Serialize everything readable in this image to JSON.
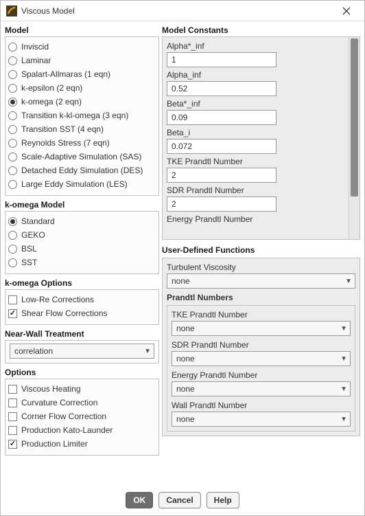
{
  "window": {
    "title": "Viscous Model"
  },
  "model": {
    "title": "Model",
    "selected": "k-omega (2 eqn)",
    "options": [
      "Inviscid",
      "Laminar",
      "Spalart-Allmaras (1 eqn)",
      "k-epsilon (2 eqn)",
      "k-omega (2 eqn)",
      "Transition k-kl-omega (3 eqn)",
      "Transition SST (4 eqn)",
      "Reynolds Stress (7 eqn)",
      "Scale-Adaptive Simulation (SAS)",
      "Detached Eddy Simulation (DES)",
      "Large Eddy Simulation (LES)"
    ]
  },
  "komega_model": {
    "title": "k-omega Model",
    "selected": "Standard",
    "options": [
      "Standard",
      "GEKO",
      "BSL",
      "SST"
    ]
  },
  "komega_options": {
    "title": "k-omega Options",
    "items": [
      {
        "label": "Low-Re Corrections",
        "checked": false
      },
      {
        "label": "Shear Flow Corrections",
        "checked": true
      }
    ]
  },
  "near_wall": {
    "title": "Near-Wall Treatment",
    "value": "correlation"
  },
  "options": {
    "title": "Options",
    "items": [
      {
        "label": "Viscous Heating",
        "checked": false
      },
      {
        "label": "Curvature Correction",
        "checked": false
      },
      {
        "label": "Corner Flow Correction",
        "checked": false
      },
      {
        "label": "Production Kato-Launder",
        "checked": false
      },
      {
        "label": "Production Limiter",
        "checked": true
      }
    ]
  },
  "constants": {
    "title": "Model Constants",
    "items": [
      {
        "label": "Alpha*_inf",
        "value": "1"
      },
      {
        "label": "Alpha_inf",
        "value": "0.52"
      },
      {
        "label": "Beta*_inf",
        "value": "0.09"
      },
      {
        "label": "Beta_i",
        "value": "0.072"
      },
      {
        "label": "TKE Prandtl Number",
        "value": "2"
      },
      {
        "label": "SDR Prandtl Number",
        "value": "2"
      }
    ],
    "next_label": "Energy Prandtl Number"
  },
  "udf": {
    "title": "User-Defined Functions",
    "turb_visc_label": "Turbulent Viscosity",
    "turb_visc_value": "none",
    "prandtl_title": "Prandtl Numbers",
    "prandtl": [
      {
        "label": "TKE Prandtl Number",
        "value": "none"
      },
      {
        "label": "SDR Prandtl Number",
        "value": "none"
      },
      {
        "label": "Energy Prandtl Number",
        "value": "none"
      },
      {
        "label": "Wall Prandtl Number",
        "value": "none"
      }
    ]
  },
  "footer": {
    "ok": "OK",
    "cancel": "Cancel",
    "help": "Help"
  }
}
